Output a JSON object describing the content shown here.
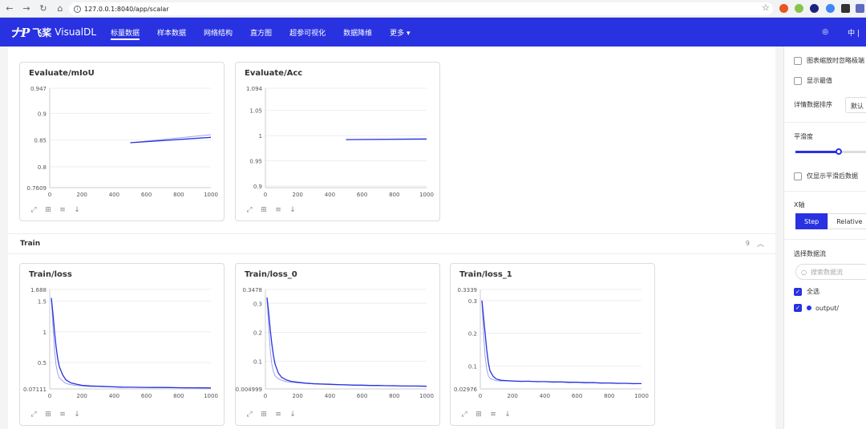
{
  "browser": {
    "url": "127.0.0.1:8040/app/scalar"
  },
  "header": {
    "logo_mark": "ナP",
    "logo_cn": "飞桨",
    "logo_name": "VisualDL",
    "nav": [
      {
        "label": "标量数据",
        "active": true
      },
      {
        "label": "样本数据",
        "active": false
      },
      {
        "label": "网络结构",
        "active": false
      },
      {
        "label": "直方图",
        "active": false
      },
      {
        "label": "超参可视化",
        "active": false
      },
      {
        "label": "数据降维",
        "active": false
      },
      {
        "label": "更多 ▾",
        "active": false
      }
    ],
    "lang": "中 |"
  },
  "sections": {
    "train": {
      "title": "Train",
      "count": "9"
    }
  },
  "cards": {
    "miou": {
      "title": "Evaluate/mIoU"
    },
    "acc": {
      "title": "Evaluate/Acc"
    },
    "loss": {
      "title": "Train/loss"
    },
    "loss0": {
      "title": "Train/loss_0"
    },
    "loss1": {
      "title": "Train/loss_1"
    }
  },
  "chart_data": [
    {
      "type": "line",
      "title": "Evaluate/mIoU",
      "xlim": [
        0,
        1000
      ],
      "ylim": [
        0.7609,
        0.947
      ],
      "xticks": [
        "0",
        "200",
        "400",
        "600",
        "800",
        "1000"
      ],
      "yticks": [
        "0.947",
        "0.9",
        "0.85",
        "0.8",
        "0.7609"
      ],
      "ytick_values": [
        0.947,
        0.9,
        0.85,
        0.8,
        0.7609
      ],
      "series": [
        {
          "style": "raw",
          "x": [
            500,
            1000
          ],
          "y": [
            0.845,
            0.86
          ]
        },
        {
          "style": "smooth",
          "x": [
            500,
            1000
          ],
          "y": [
            0.845,
            0.855
          ]
        }
      ]
    },
    {
      "type": "line",
      "title": "Evaluate/Acc",
      "xlim": [
        0,
        1000
      ],
      "ylim": [
        0.8968,
        1.094
      ],
      "xticks": [
        "0",
        "200",
        "400",
        "600",
        "800",
        "1000"
      ],
      "yticks": [
        "1.094",
        "1.05",
        "1",
        "0.95",
        "0.9"
      ],
      "ytick_values": [
        1.094,
        1.05,
        1.0,
        0.95,
        0.9
      ],
      "series": [
        {
          "style": "raw",
          "x": [
            500,
            1000
          ],
          "y": [
            0.992,
            0.994
          ]
        },
        {
          "style": "smooth",
          "x": [
            500,
            1000
          ],
          "y": [
            0.992,
            0.993
          ]
        }
      ]
    },
    {
      "type": "line",
      "title": "Train/loss",
      "xlim": [
        0,
        1000
      ],
      "ylim": [
        0.07111,
        1.688
      ],
      "xticks": [
        "0",
        "200",
        "400",
        "600",
        "800",
        "1000"
      ],
      "yticks": [
        "1.688",
        "1.5",
        "1",
        "0.5",
        "0.07111"
      ],
      "ytick_values": [
        1.688,
        1.5,
        1.0,
        0.5,
        0.07111
      ],
      "series": [
        {
          "style": "raw",
          "x": [
            10,
            20,
            30,
            40,
            50,
            60,
            80,
            100,
            130,
            160,
            200,
            250,
            300,
            350,
            400,
            450,
            500,
            550,
            600,
            650,
            700,
            750,
            800,
            850,
            900,
            950,
            1000
          ],
          "y": [
            1.55,
            1.1,
            0.7,
            0.45,
            0.32,
            0.25,
            0.2,
            0.16,
            0.14,
            0.13,
            0.12,
            0.11,
            0.11,
            0.105,
            0.1,
            0.1,
            0.098,
            0.096,
            0.095,
            0.094,
            0.093,
            0.092,
            0.09,
            0.089,
            0.088,
            0.087,
            0.086
          ]
        },
        {
          "style": "smooth",
          "x": [
            10,
            20,
            30,
            40,
            50,
            60,
            80,
            100,
            130,
            160,
            200,
            250,
            300,
            350,
            400,
            450,
            500,
            550,
            600,
            650,
            700,
            750,
            800,
            850,
            900,
            950,
            1000
          ],
          "y": [
            1.55,
            1.3,
            1.0,
            0.75,
            0.56,
            0.43,
            0.3,
            0.22,
            0.17,
            0.15,
            0.13,
            0.12,
            0.115,
            0.11,
            0.105,
            0.1,
            0.099,
            0.097,
            0.096,
            0.095,
            0.094,
            0.093,
            0.091,
            0.09,
            0.089,
            0.088,
            0.087
          ]
        }
      ]
    },
    {
      "type": "line",
      "title": "Train/loss_0",
      "xlim": [
        0,
        1000
      ],
      "ylim": [
        0.004999,
        0.3478
      ],
      "xticks": [
        "0",
        "200",
        "400",
        "600",
        "800",
        "1000"
      ],
      "yticks": [
        "0.3478",
        "0.3",
        "0.2",
        "0.1",
        "0.004999"
      ],
      "ytick_values": [
        0.3478,
        0.3,
        0.2,
        0.1,
        0.004999
      ],
      "series": [
        {
          "style": "raw",
          "x": [
            10,
            20,
            30,
            40,
            50,
            60,
            80,
            100,
            130,
            160,
            200,
            250,
            300,
            350,
            400,
            450,
            500,
            550,
            600,
            650,
            700,
            750,
            800,
            850,
            900,
            950,
            1000
          ],
          "y": [
            0.32,
            0.22,
            0.14,
            0.09,
            0.065,
            0.05,
            0.04,
            0.035,
            0.03,
            0.028,
            0.026,
            0.024,
            0.022,
            0.021,
            0.02,
            0.019,
            0.018,
            0.018,
            0.017,
            0.017,
            0.016,
            0.016,
            0.015,
            0.015,
            0.015,
            0.014,
            0.014
          ]
        },
        {
          "style": "smooth",
          "x": [
            10,
            20,
            30,
            40,
            50,
            60,
            80,
            100,
            130,
            160,
            200,
            250,
            300,
            350,
            400,
            450,
            500,
            550,
            600,
            650,
            700,
            750,
            800,
            850,
            900,
            950,
            1000
          ],
          "y": [
            0.32,
            0.27,
            0.21,
            0.16,
            0.12,
            0.09,
            0.06,
            0.045,
            0.036,
            0.031,
            0.028,
            0.025,
            0.023,
            0.022,
            0.021,
            0.02,
            0.019,
            0.018,
            0.018,
            0.017,
            0.017,
            0.016,
            0.016,
            0.015,
            0.015,
            0.015,
            0.014
          ]
        }
      ]
    },
    {
      "type": "line",
      "title": "Train/loss_1",
      "xlim": [
        0,
        1000
      ],
      "ylim": [
        0.02976,
        0.3339
      ],
      "xticks": [
        "0",
        "200",
        "400",
        "600",
        "800",
        "1000"
      ],
      "yticks": [
        "0.3339",
        "0.3",
        "0.2",
        "0.1",
        "0.02976"
      ],
      "ytick_values": [
        0.3339,
        0.3,
        0.2,
        0.1,
        0.02976
      ],
      "series": [
        {
          "style": "raw",
          "x": [
            10,
            20,
            30,
            40,
            50,
            60,
            80,
            100,
            130,
            160,
            200,
            250,
            300,
            350,
            400,
            450,
            500,
            550,
            600,
            650,
            700,
            750,
            800,
            850,
            900,
            950,
            1000
          ],
          "y": [
            0.3,
            0.2,
            0.13,
            0.09,
            0.07,
            0.062,
            0.058,
            0.055,
            0.054,
            0.055,
            0.053,
            0.052,
            0.054,
            0.051,
            0.052,
            0.05,
            0.051,
            0.049,
            0.05,
            0.048,
            0.049,
            0.047,
            0.048,
            0.046,
            0.047,
            0.045,
            0.046
          ]
        },
        {
          "style": "smooth",
          "x": [
            10,
            20,
            30,
            40,
            50,
            60,
            80,
            100,
            130,
            160,
            200,
            250,
            300,
            350,
            400,
            450,
            500,
            550,
            600,
            650,
            700,
            750,
            800,
            850,
            900,
            950,
            1000
          ],
          "y": [
            0.3,
            0.25,
            0.2,
            0.15,
            0.11,
            0.085,
            0.068,
            0.06,
            0.056,
            0.055,
            0.054,
            0.053,
            0.053,
            0.052,
            0.052,
            0.051,
            0.051,
            0.05,
            0.05,
            0.049,
            0.049,
            0.048,
            0.048,
            0.047,
            0.047,
            0.046,
            0.046
          ]
        }
      ]
    }
  ],
  "sidebar": {
    "ignore_outliers": "图表缩放时忽略极端",
    "show_extremes": "显示最值",
    "sort_label": "详情数据排序",
    "sort_value": "默认",
    "smoothing_label": "平滑度",
    "smoothing_value": 0.6,
    "only_smoothed": "仅显示平滑后数据",
    "xaxis_label": "X轴",
    "xaxis_step": "Step",
    "xaxis_relative": "Relative",
    "runs_label": "选择数据流",
    "search_placeholder": "搜索数据流",
    "select_all": "全选",
    "run_name": "output/"
  },
  "colors": {
    "brand": "#2932e1",
    "raw_line": "#9fa3e9",
    "smooth_line": "#2932e1"
  }
}
